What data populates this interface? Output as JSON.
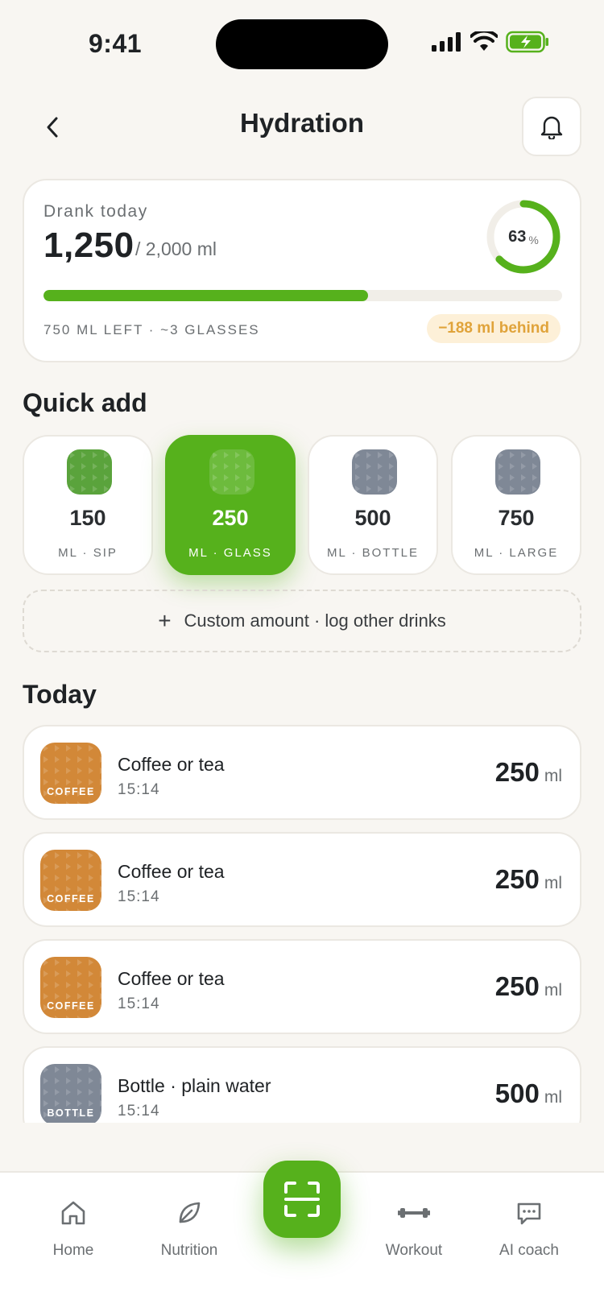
{
  "status_bar": {
    "time": "9:41"
  },
  "header": {
    "title": "Hydration"
  },
  "summary": {
    "label": "Drank today",
    "value": "1,250",
    "goal": "/ 2,000 ml",
    "percent": "63",
    "percent_sign": "%",
    "progress_fraction": 0.625,
    "left_text": "750 ML LEFT · ~3 GLASSES",
    "behind_badge": "−188 ml behind"
  },
  "quick_add": {
    "title": "Quick add",
    "tiles": [
      {
        "amount": "150",
        "label": "ML · SIP",
        "selected": false
      },
      {
        "amount": "250",
        "label": "ML · GLASS",
        "selected": true
      },
      {
        "amount": "500",
        "label": "ML · BOTTLE",
        "selected": false
      },
      {
        "amount": "750",
        "label": "ML · LARGE",
        "selected": false
      }
    ],
    "custom_label": "Custom amount · log other drinks"
  },
  "today": {
    "title": "Today",
    "entries": [
      {
        "thumb_label": "COFFEE",
        "name": "Coffee or tea",
        "time": "15:14",
        "value": "250",
        "unit": "ml"
      },
      {
        "thumb_label": "COFFEE",
        "name": "Coffee or tea",
        "time": "15:14",
        "value": "250",
        "unit": "ml"
      },
      {
        "thumb_label": "COFFEE",
        "name": "Coffee or tea",
        "time": "15:14",
        "value": "250",
        "unit": "ml"
      },
      {
        "thumb_label": "BOTTLE",
        "name": "Bottle · plain water",
        "time": "15:14",
        "value": "500",
        "unit": "ml"
      }
    ]
  },
  "nav": {
    "items": [
      {
        "label": "Home",
        "icon": "home-icon"
      },
      {
        "label": "Nutrition",
        "icon": "leaf-icon"
      },
      {
        "label": "Workout",
        "icon": "dumbbell-icon"
      },
      {
        "label": "AI coach",
        "icon": "chat-icon"
      }
    ],
    "center_icon": "scan-icon"
  },
  "colors": {
    "accent": "#56b11c",
    "background": "#f8f6f2",
    "coffee": "#d28838",
    "bottle": "#7f8896",
    "warning": "#e0a33a"
  }
}
